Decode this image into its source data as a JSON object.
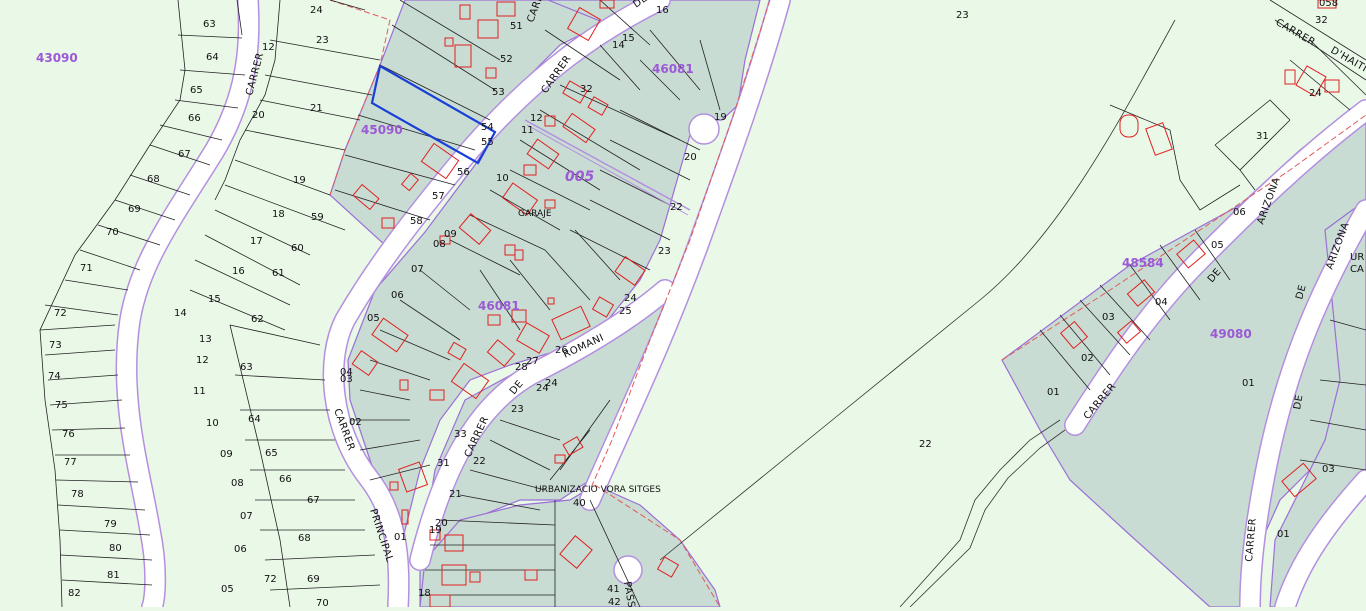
{
  "map": {
    "colors": {
      "background": "#eaf8e8",
      "block_fill": "#c9dcd3",
      "road_fill": "#ffffff",
      "road_edge": "#b48fe0",
      "parcel_line": "#222222",
      "building_stroke": "#e02020",
      "district_text": "#9b59d6",
      "selection": "#1a3fd8",
      "boundary_dash": "#e05a5a"
    },
    "districts": [
      {
        "id": "d1",
        "text": "43090"
      },
      {
        "id": "d2",
        "text": "45090"
      },
      {
        "id": "d3",
        "text": "46081"
      },
      {
        "id": "d4",
        "text": "46081"
      },
      {
        "id": "d5",
        "text": "005"
      },
      {
        "id": "d6",
        "text": "48584"
      },
      {
        "id": "d7",
        "text": "49080"
      }
    ],
    "street_names": [
      {
        "id": "s1",
        "text": "CARRER"
      },
      {
        "id": "s2",
        "text": "CARRER"
      },
      {
        "id": "s3",
        "text": "PRINCIPAL"
      },
      {
        "id": "s4",
        "text": "CARRER"
      },
      {
        "id": "s5",
        "text": "DEL"
      },
      {
        "id": "s6",
        "text": "ROMANI"
      },
      {
        "id": "s7",
        "text": "CARRER"
      },
      {
        "id": "s8",
        "text": "DE"
      },
      {
        "id": "s9",
        "text": "CARRER"
      },
      {
        "id": "s10",
        "text": "DE"
      },
      {
        "id": "s11",
        "text": "ARIZONA"
      },
      {
        "id": "s12",
        "text": "CARRER"
      },
      {
        "id": "s13",
        "text": "DE"
      },
      {
        "id": "s14",
        "text": "ARIZONA"
      },
      {
        "id": "s15",
        "text": "CARRER"
      },
      {
        "id": "s16",
        "text": "D'HAITI"
      },
      {
        "id": "s17",
        "text": "PASS"
      },
      {
        "id": "s18",
        "text": "CARRER"
      },
      {
        "id": "s19",
        "text": "DE"
      }
    ],
    "place_labels": [
      {
        "id": "p1",
        "text": "URBANIZACIO VORA SITGES"
      },
      {
        "id": "p2",
        "text": "GARAJE"
      }
    ],
    "parcel_numbers": [
      {
        "id": "n1",
        "text": "63"
      },
      {
        "id": "n2",
        "text": "64"
      },
      {
        "id": "n3",
        "text": "65"
      },
      {
        "id": "n4",
        "text": "66"
      },
      {
        "id": "n5",
        "text": "67"
      },
      {
        "id": "n6",
        "text": "68"
      },
      {
        "id": "n7",
        "text": "69"
      },
      {
        "id": "n8",
        "text": "70"
      },
      {
        "id": "n9",
        "text": "71"
      },
      {
        "id": "n10",
        "text": "72"
      },
      {
        "id": "n11",
        "text": "73"
      },
      {
        "id": "n12",
        "text": "74"
      },
      {
        "id": "n13",
        "text": "75"
      },
      {
        "id": "n14",
        "text": "76"
      },
      {
        "id": "n15",
        "text": "77"
      },
      {
        "id": "n16",
        "text": "78"
      },
      {
        "id": "n17",
        "text": "79"
      },
      {
        "id": "n18",
        "text": "80"
      },
      {
        "id": "n19",
        "text": "81"
      },
      {
        "id": "n20",
        "text": "82"
      },
      {
        "id": "n21",
        "text": "24"
      },
      {
        "id": "n22",
        "text": "23"
      },
      {
        "id": "n23",
        "text": "12"
      },
      {
        "id": "n24",
        "text": "21"
      },
      {
        "id": "n25",
        "text": "20"
      },
      {
        "id": "n26",
        "text": "19"
      },
      {
        "id": "n27",
        "text": "18"
      },
      {
        "id": "n28",
        "text": "17"
      },
      {
        "id": "n29",
        "text": "16"
      },
      {
        "id": "n30",
        "text": "15"
      },
      {
        "id": "n31",
        "text": "14"
      },
      {
        "id": "n32",
        "text": "13"
      },
      {
        "id": "n33",
        "text": "12"
      },
      {
        "id": "n34",
        "text": "11"
      },
      {
        "id": "n35",
        "text": "10"
      },
      {
        "id": "n36",
        "text": "09"
      },
      {
        "id": "n37",
        "text": "08"
      },
      {
        "id": "n38",
        "text": "07"
      },
      {
        "id": "n39",
        "text": "06"
      },
      {
        "id": "n40",
        "text": "05"
      },
      {
        "id": "n41",
        "text": "59"
      },
      {
        "id": "n42",
        "text": "60"
      },
      {
        "id": "n43",
        "text": "61"
      },
      {
        "id": "n44",
        "text": "62"
      },
      {
        "id": "n45",
        "text": "63"
      },
      {
        "id": "n46",
        "text": "64"
      },
      {
        "id": "n47",
        "text": "65"
      },
      {
        "id": "n48",
        "text": "66"
      },
      {
        "id": "n49",
        "text": "67"
      },
      {
        "id": "n50",
        "text": "68"
      },
      {
        "id": "n51",
        "text": "69"
      },
      {
        "id": "n52",
        "text": "70"
      },
      {
        "id": "n53",
        "text": "72"
      },
      {
        "id": "n54",
        "text": "51"
      },
      {
        "id": "n55",
        "text": "52"
      },
      {
        "id": "n56",
        "text": "53"
      },
      {
        "id": "n57",
        "text": "54"
      },
      {
        "id": "n58",
        "text": "55"
      },
      {
        "id": "n59",
        "text": "56"
      },
      {
        "id": "n60",
        "text": "57"
      },
      {
        "id": "n61",
        "text": "58"
      },
      {
        "id": "n62",
        "text": "09"
      },
      {
        "id": "n63",
        "text": "08"
      },
      {
        "id": "n64",
        "text": "07"
      },
      {
        "id": "n65",
        "text": "06"
      },
      {
        "id": "n66",
        "text": "05"
      },
      {
        "id": "n67",
        "text": "04"
      },
      {
        "id": "n68",
        "text": "03"
      },
      {
        "id": "n69",
        "text": "02"
      },
      {
        "id": "n70",
        "text": "01"
      },
      {
        "id": "n71",
        "text": "10"
      },
      {
        "id": "n72",
        "text": "11"
      },
      {
        "id": "n73",
        "text": "12"
      },
      {
        "id": "n74",
        "text": "32"
      },
      {
        "id": "n75",
        "text": "16"
      },
      {
        "id": "n76",
        "text": "15"
      },
      {
        "id": "n77",
        "text": "14"
      },
      {
        "id": "n78",
        "text": "19"
      },
      {
        "id": "n79",
        "text": "20"
      },
      {
        "id": "n80",
        "text": "22"
      },
      {
        "id": "n81",
        "text": "23"
      },
      {
        "id": "n82",
        "text": "24"
      },
      {
        "id": "n83",
        "text": "25"
      },
      {
        "id": "n84",
        "text": "26"
      },
      {
        "id": "n85",
        "text": "27"
      },
      {
        "id": "n86",
        "text": "28"
      },
      {
        "id": "n87",
        "text": "24"
      },
      {
        "id": "n88",
        "text": "24"
      },
      {
        "id": "n89",
        "text": "23"
      },
      {
        "id": "n90",
        "text": "22"
      },
      {
        "id": "n91",
        "text": "21"
      },
      {
        "id": "n92",
        "text": "20"
      },
      {
        "id": "n93",
        "text": "19"
      },
      {
        "id": "n94",
        "text": "33"
      },
      {
        "id": "n95",
        "text": "31"
      },
      {
        "id": "n96",
        "text": "40"
      },
      {
        "id": "n97",
        "text": "41"
      },
      {
        "id": "n98",
        "text": "42"
      },
      {
        "id": "n99",
        "text": "18"
      },
      {
        "id": "n100",
        "text": "23"
      },
      {
        "id": "n101",
        "text": "22"
      },
      {
        "id": "n102",
        "text": "01"
      },
      {
        "id": "n103",
        "text": "02"
      },
      {
        "id": "n104",
        "text": "03"
      },
      {
        "id": "n105",
        "text": "04"
      },
      {
        "id": "n106",
        "text": "05"
      },
      {
        "id": "n107",
        "text": "06"
      },
      {
        "id": "n108",
        "text": "31"
      },
      {
        "id": "n109",
        "text": "24"
      },
      {
        "id": "n110",
        "text": "32"
      },
      {
        "id": "n111",
        "text": "058"
      },
      {
        "id": "n112",
        "text": "01"
      },
      {
        "id": "n113",
        "text": "03"
      },
      {
        "id": "n114",
        "text": "01"
      },
      {
        "id": "n115",
        "text": "UR"
      },
      {
        "id": "n116",
        "text": "CA"
      }
    ]
  }
}
